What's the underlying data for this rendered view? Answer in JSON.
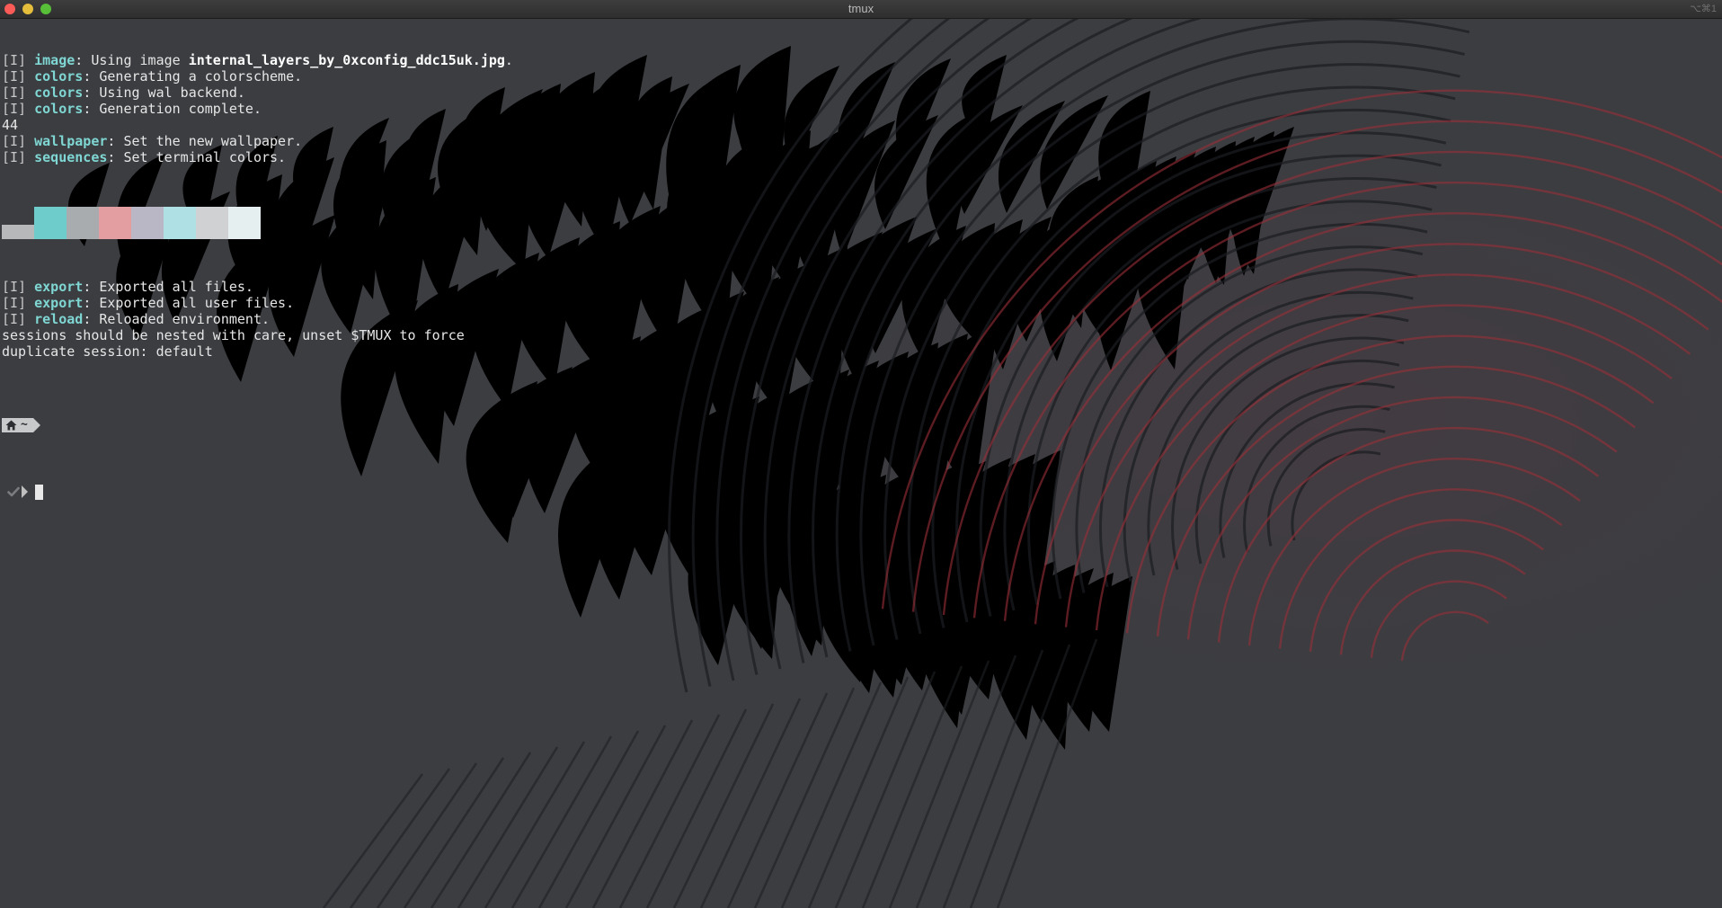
{
  "window": {
    "title": "tmux",
    "shortcut": "⌥⌘1"
  },
  "terminal": {
    "lines_top": [
      {
        "bracket": "[I]",
        "module": "image",
        "text": ": Using image ",
        "bold": "internal_layers_by_0xconfig_ddc15uk.jpg",
        "tail": "."
      },
      {
        "bracket": "[I]",
        "module": "colors",
        "text": ": Generating a colorscheme."
      },
      {
        "bracket": "[I]",
        "module": "colors",
        "text": ": Using wal backend."
      },
      {
        "bracket": "[I]",
        "module": "colors",
        "text": ": Generation complete."
      },
      {
        "plain": "44"
      },
      {
        "bracket": "[I]",
        "module": "wallpaper",
        "text": ": Set the new wallpaper."
      },
      {
        "bracket": "[I]",
        "module": "sequences",
        "text": ": Set terminal colors."
      }
    ],
    "palette": [
      "#b6b8ba",
      "#6ecdca",
      "#a9acae",
      "#e39ea2",
      "#b9b7c6",
      "#aee0e4",
      "#cfd1d3",
      "#e5eff0"
    ],
    "lines_bottom": [
      {
        "bracket": "[I]",
        "module": "export",
        "text": ": Exported all files."
      },
      {
        "bracket": "[I]",
        "module": "export",
        "text": ": Exported all user files."
      },
      {
        "bracket": "[I]",
        "module": "reload",
        "text": ": Reloaded environment."
      },
      {
        "plain": "sessions should be nested with care, unset $TMUX to force"
      },
      {
        "plain": "duplicate session: default"
      }
    ],
    "prompt": {
      "home_icon": "home-icon",
      "path": "~",
      "status_icon": "checkmark-icon"
    }
  }
}
